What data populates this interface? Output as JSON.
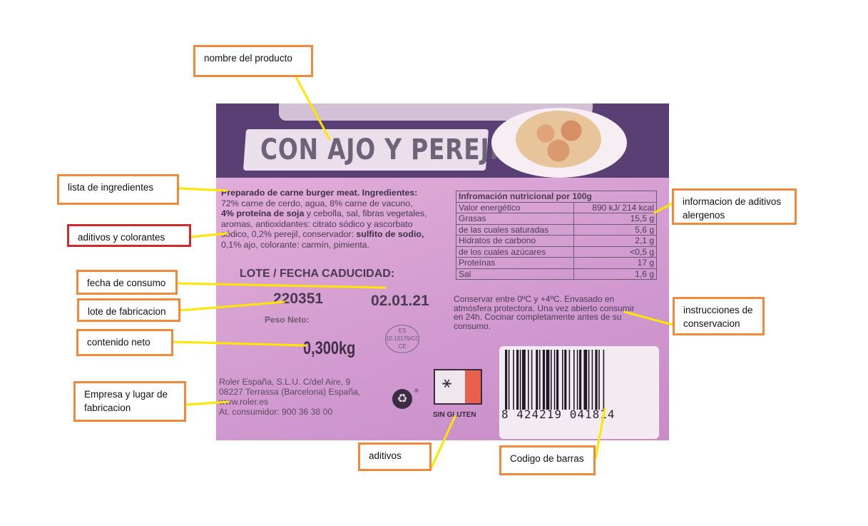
{
  "product": {
    "title": "CON AJO Y PEREJIL",
    "ingredients_heading": "Preparado de carne burger meat. Ingredientes:",
    "ingredients_line1": "72% carne de cerdo, agua, 8% carne de vacuno,",
    "ingredients_bold1": "4% proteína de soja",
    "ingredients_line2": " y cebolla, sal, fibras vegetales,",
    "ingredients_line3": "aromas, antioxidantes: citrato sódico y ascorbato",
    "ingredients_line4": "sódico, 0,2% perejil, conservador: ",
    "ingredients_bold2": "sulfito de sodio,",
    "ingredients_line5": "0,1% ajo, colorante: carmín, pimienta.",
    "lote_heading": "LOTE / FECHA CADUCIDAD:",
    "lote_number": "220351",
    "expiry_date": "02.01.21",
    "peso_label": "Peso Neto:",
    "peso_value": "0,300kg",
    "health_mark_line1": "ES",
    "health_mark_line2": "10.19176/CC",
    "health_mark_line3": "CE",
    "company_line1": "Roler España, S.L.U. C/del Aire, 9",
    "company_line2": "08227 Terrassa (Barcelona) España,",
    "company_line3": "www.roler.es",
    "company_line4": "At. consumidor: 900 36 38 00",
    "gluten_label": "SIN GLUTEN",
    "barcode_number": "8 424219 041814"
  },
  "nutrition": {
    "title": "Infromación nutricional por 100g",
    "rows": [
      {
        "label": "Valor energético",
        "value": "890 kJ/ 214 kcal"
      },
      {
        "label": "Grasas",
        "value": "15,5 g"
      },
      {
        "label": "de las cuales saturadas",
        "value": "5,6 g"
      },
      {
        "label": "Hidratos de carbono",
        "value": "2,1 g"
      },
      {
        "label": "de los cuales azúcares",
        "value": "<0,5 g"
      },
      {
        "label": "Proteínas",
        "value": "17 g"
      },
      {
        "label": "Sal",
        "value": "1,6 g"
      }
    ]
  },
  "conservation": "Conservar entre 0ºC y +4ºC. Envasado en atmósfera protectora. Una vez abierto consumir en 24h. Cocinar completamente antes de su consumo.",
  "callouts": {
    "nombre": "nombre del producto",
    "ingredientes": "lista de ingredientes",
    "aditivos_colorantes": "aditivos y colorantes",
    "fecha": "fecha de consumo",
    "lote": "lote de fabricacion",
    "contenido": "contenido neto",
    "empresa": "Empresa y lugar de fabricacion",
    "aditivos": "aditivos",
    "codigo": "Codigo de barras",
    "alergenos": "informacion de aditivos alergenos",
    "instrucciones": "instrucciones de conservacion"
  },
  "colors": {
    "callout_border": "#f0893c",
    "callout_border_alt": "#d22a2a",
    "leader_line": "#ffe600"
  }
}
